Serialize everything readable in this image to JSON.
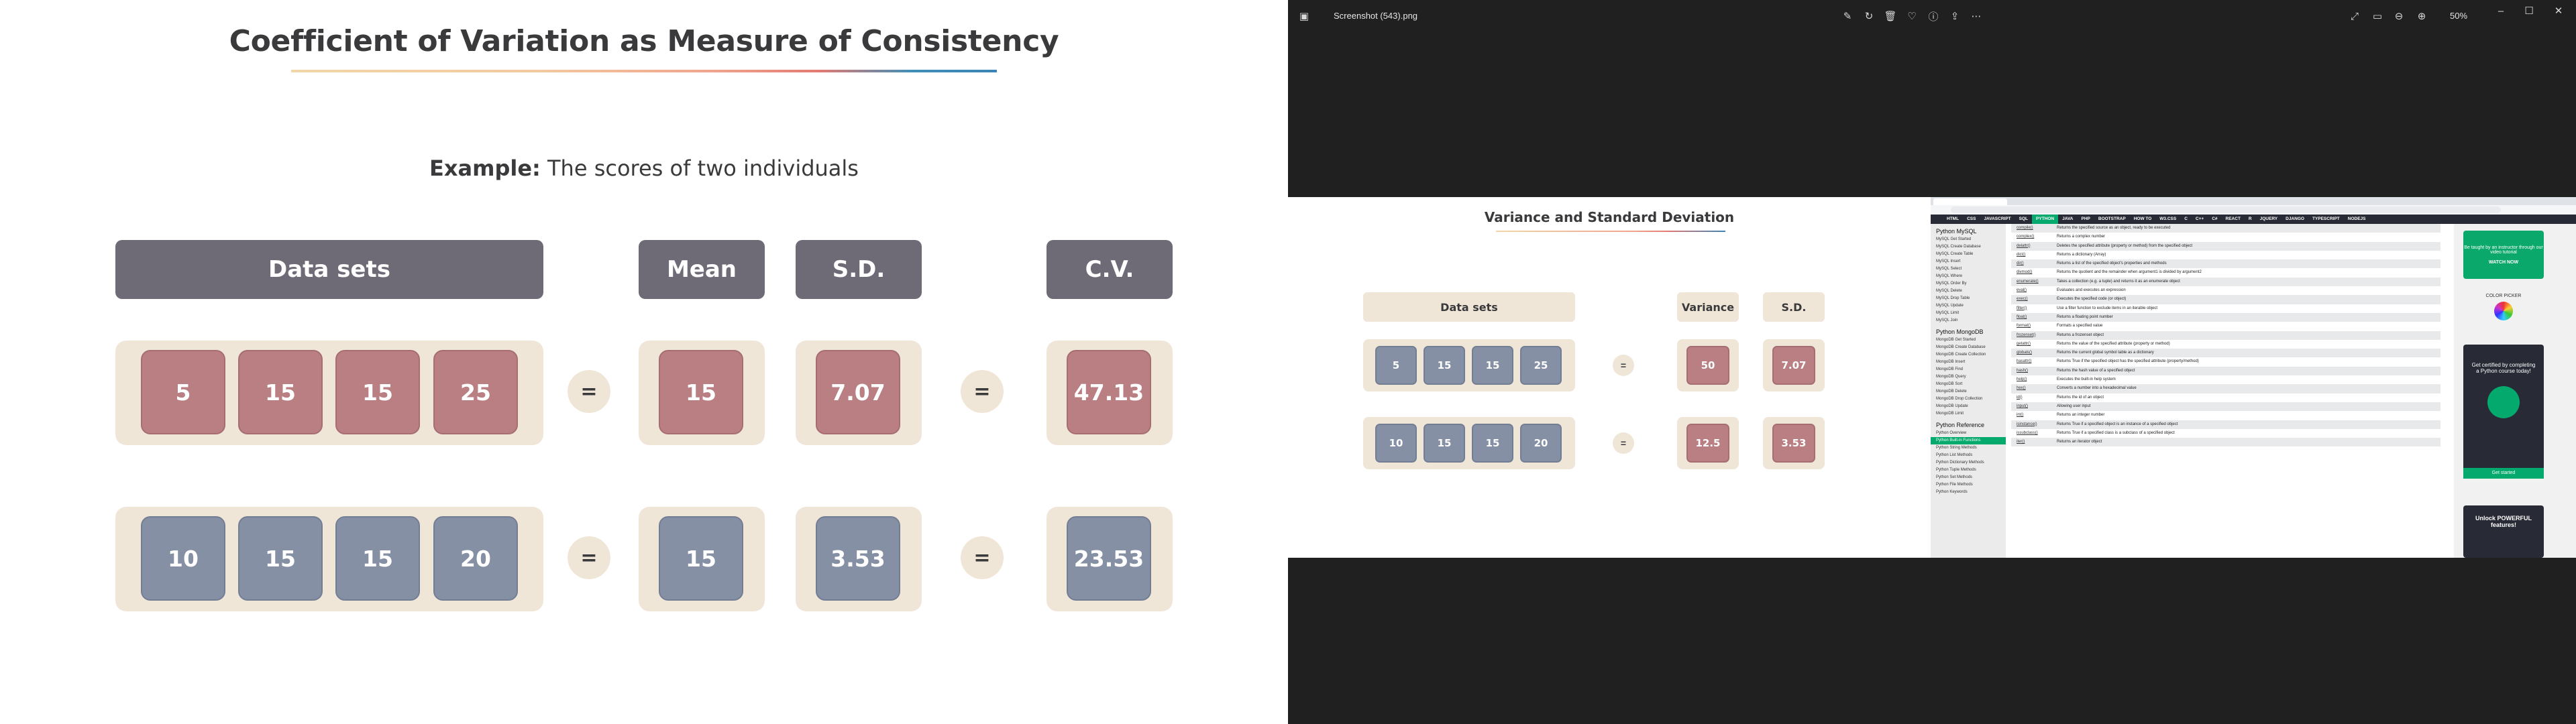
{
  "slide": {
    "title": "Coefficient of Variation as Measure of Consistency",
    "subtitle_bold": "Example:",
    "subtitle_rest": " The scores of two individuals",
    "headers": {
      "data_sets": "Data sets",
      "mean": "Mean",
      "sd": "S.D.",
      "cv": "C.V."
    },
    "equals": "=",
    "rows": [
      {
        "values": [
          "5",
          "15",
          "15",
          "25"
        ],
        "mean": "15",
        "sd": "7.07",
        "cv": "47.13"
      },
      {
        "values": [
          "10",
          "15",
          "15",
          "20"
        ],
        "mean": "15",
        "sd": "3.53",
        "cv": "23.53"
      }
    ],
    "colors": {
      "header": "#6e6a76",
      "panel": "#efe6d8",
      "red_tile": "#b97f83",
      "blue_tile": "#8690a5"
    }
  },
  "viewer": {
    "file_name": "Screenshot (543).png",
    "zoom": "50%",
    "icons": [
      "image-icon",
      "edit-icon",
      "rotate-icon",
      "delete-icon",
      "favorite-icon",
      "info-icon",
      "share-icon",
      "more-icon",
      "fullscreen-icon",
      "slideshow-icon",
      "zoom-out-icon",
      "zoom-in-icon",
      "minimize-icon",
      "maximize-icon",
      "close-icon"
    ],
    "image": {
      "slide": {
        "title": "Variance and Standard Deviation",
        "headers": {
          "data_sets": "Data sets",
          "variance": "Variance",
          "sd": "S.D."
        },
        "equals": "=",
        "rows": [
          {
            "values": [
              "5",
              "15",
              "15",
              "25"
            ],
            "variance": "50",
            "sd": "7.07"
          },
          {
            "values": [
              "10",
              "15",
              "15",
              "20"
            ],
            "variance": "12.5",
            "sd": "3.53"
          }
        ]
      },
      "browser": {
        "nav": [
          "HTML",
          "CSS",
          "JAVASCRIPT",
          "SQL",
          "PYTHON",
          "JAVA",
          "PHP",
          "BOOTSTRAP",
          "HOW TO",
          "W3.CSS",
          "C",
          "C++",
          "C#",
          "REACT",
          "R",
          "JQUERY",
          "DJANGO",
          "TYPESCRIPT",
          "NODEJS"
        ],
        "sidebar_heading_1": "Python MySQL",
        "sidebar_1": [
          "MySQL Get Started",
          "MySQL Create Database",
          "MySQL Create Table",
          "MySQL Insert",
          "MySQL Select",
          "MySQL Where",
          "MySQL Order By",
          "MySQL Delete",
          "MySQL Drop Table",
          "MySQL Update",
          "MySQL Limit",
          "MySQL Join"
        ],
        "sidebar_heading_2": "Python MongoDB",
        "sidebar_2": [
          "MongoDB Get Started",
          "MongoDB Create Database",
          "MongoDB Create Collection",
          "MongoDB Insert",
          "MongoDB Find",
          "MongoDB Query",
          "MongoDB Sort",
          "MongoDB Delete",
          "MongoDB Drop Collection",
          "MongoDB Update",
          "MongoDB Limit"
        ],
        "sidebar_heading_3": "Python Reference",
        "sidebar_3": [
          "Python Overview",
          "Python Built-in Functions",
          "Python String Methods",
          "Python List Methods",
          "Python Dictionary Methods",
          "Python Tuple Methods",
          "Python Set Methods",
          "Python File Methods",
          "Python Keywords"
        ],
        "functions": [
          [
            "compile()",
            "Returns the specified source as an object, ready to be executed"
          ],
          [
            "complex()",
            "Returns a complex number"
          ],
          [
            "delattr()",
            "Deletes the specified attribute (property or method) from the specified object"
          ],
          [
            "dict()",
            "Returns a dictionary (Array)"
          ],
          [
            "dir()",
            "Returns a list of the specified object's properties and methods"
          ],
          [
            "divmod()",
            "Returns the quotient and the remainder when argument1 is divided by argument2"
          ],
          [
            "enumerate()",
            "Takes a collection (e.g. a tuple) and returns it as an enumerate object"
          ],
          [
            "eval()",
            "Evaluates and executes an expression"
          ],
          [
            "exec()",
            "Executes the specified code (or object)"
          ],
          [
            "filter()",
            "Use a filter function to exclude items in an iterable object"
          ],
          [
            "float()",
            "Returns a floating point number"
          ],
          [
            "format()",
            "Formats a specified value"
          ],
          [
            "frozenset()",
            "Returns a frozenset object"
          ],
          [
            "getattr()",
            "Returns the value of the specified attribute (property or method)"
          ],
          [
            "globals()",
            "Returns the current global symbol table as a dictionary"
          ],
          [
            "hasattr()",
            "Returns True if the specified object has the specified attribute (property/method)"
          ],
          [
            "hash()",
            "Returns the hash value of a specified object"
          ],
          [
            "help()",
            "Executes the built-in help system"
          ],
          [
            "hex()",
            "Converts a number into a hexadecimal value"
          ],
          [
            "id()",
            "Returns the id of an object"
          ],
          [
            "input()",
            "Allowing user input"
          ],
          [
            "int()",
            "Returns an integer number"
          ],
          [
            "isinstance()",
            "Returns True if a specified object is an instance of a specified object"
          ],
          [
            "issubclass()",
            "Returns True if a specified class is a subclass of a specified object"
          ],
          [
            "iter()",
            "Returns an iterator object"
          ]
        ],
        "ad1": "Be taught by an instructor through our video tutorial",
        "ad1_button": "WATCH NOW",
        "color_picker": "COLOR PICKER",
        "ad2_title": "Get certified by completing a Python course today!",
        "ad2_button": "Get started",
        "ad3": "Unlock POWERFUL features!"
      }
    }
  }
}
